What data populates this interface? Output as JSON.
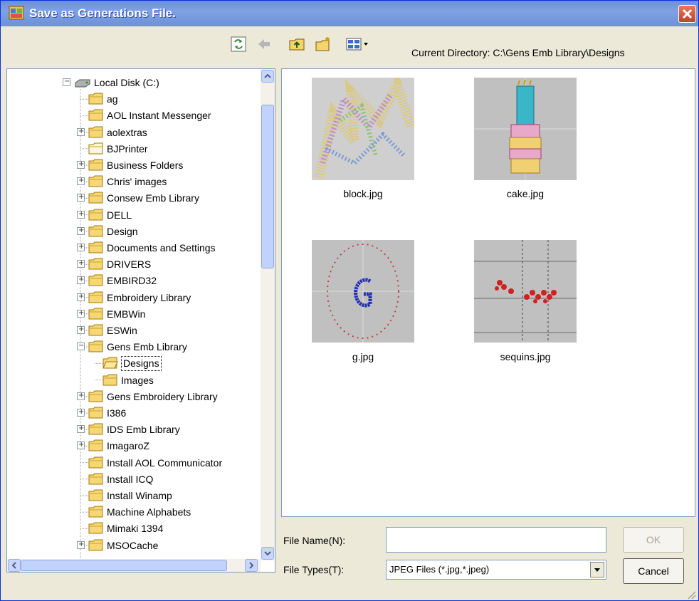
{
  "window": {
    "title": "Save as Generations File."
  },
  "toolbar": {
    "current_directory_label": "Current Directory: C:\\Gens Emb Library\\Designs"
  },
  "tree": {
    "root": "Local Disk (C:)",
    "items": [
      {
        "label": "ag",
        "expandable": false
      },
      {
        "label": "AOL Instant Messenger",
        "expandable": false
      },
      {
        "label": "aolextras",
        "expandable": true
      },
      {
        "label": "BJPrinter",
        "expandable": false
      },
      {
        "label": "Business Folders",
        "expandable": true
      },
      {
        "label": "Chris' images",
        "expandable": true
      },
      {
        "label": "Consew Emb Library",
        "expandable": true
      },
      {
        "label": "DELL",
        "expandable": true
      },
      {
        "label": "Design",
        "expandable": true
      },
      {
        "label": "Documents and Settings",
        "expandable": true
      },
      {
        "label": "DRIVERS",
        "expandable": true
      },
      {
        "label": "EMBIRD32",
        "expandable": true
      },
      {
        "label": "Embroidery Library",
        "expandable": true
      },
      {
        "label": "EMBWin",
        "expandable": true
      },
      {
        "label": "ESWin",
        "expandable": true
      },
      {
        "label": "Gens Emb Library",
        "expandable": true,
        "expanded": true
      },
      {
        "label": "Designs",
        "child": true,
        "selected": true
      },
      {
        "label": "Images",
        "child": true
      },
      {
        "label": "Gens Embroidery Library",
        "expandable": true
      },
      {
        "label": "I386",
        "expandable": true
      },
      {
        "label": "IDS Emb Library",
        "expandable": true
      },
      {
        "label": "ImagaroZ",
        "expandable": true
      },
      {
        "label": "Install AOL Communicator",
        "expandable": false
      },
      {
        "label": "Install ICQ",
        "expandable": false
      },
      {
        "label": "Install Winamp",
        "expandable": false
      },
      {
        "label": "Machine Alphabets",
        "expandable": false
      },
      {
        "label": "Mimaki 1394",
        "expandable": false
      },
      {
        "label": "MSOCache",
        "expandable": true
      }
    ]
  },
  "files": [
    {
      "name": "block.jpg"
    },
    {
      "name": "cake.jpg"
    },
    {
      "name": "g.jpg"
    },
    {
      "name": "sequins.jpg"
    }
  ],
  "form": {
    "file_name_label": "File Name(N):",
    "file_name_value": "",
    "file_types_label": "File Types(T):",
    "file_types_value": "JPEG Files (*.jpg,*.jpeg)",
    "ok_label": "OK",
    "cancel_label": "Cancel"
  },
  "colors": {
    "titlebar": "#7fa2e4",
    "face": "#ece9d8",
    "border": "#7f9db9"
  }
}
